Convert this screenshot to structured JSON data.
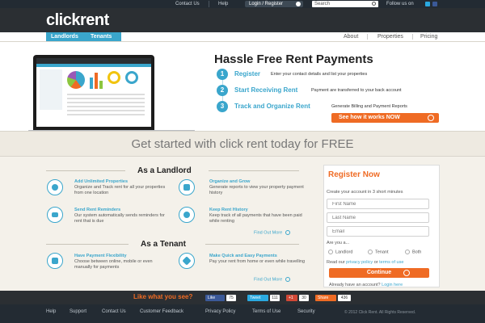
{
  "topbar": {
    "contact_us": "Contact Us",
    "help": "Help",
    "login_register": "Login / Register",
    "search_placeholder": "Search",
    "follow_us": "Follow us on"
  },
  "header": {
    "logo_click": "click",
    "logo_rent": "rent"
  },
  "nav": {
    "user_tabs": [
      "Landlords",
      "Tenants"
    ],
    "links": [
      "About",
      "Properties",
      "Pricing"
    ]
  },
  "hero": {
    "title": "Hassle Free Rent Payments",
    "steps": [
      {
        "num": "1",
        "title": "Register",
        "desc": "Enter your contact details and list your properties"
      },
      {
        "num": "2",
        "title": "Start Receiving Rent",
        "desc": "Payment are transferred to your back account"
      },
      {
        "num": "3",
        "title": "Track and Organize Rent",
        "desc": "Generate Billing and Payment Reports"
      }
    ],
    "cta": "See how it works NOW"
  },
  "banner": {
    "text": "Get started with click rent today for FREE"
  },
  "landlord": {
    "heading": "As a Landlord",
    "features": [
      {
        "title": "Add Unlimited Properties",
        "desc": "Organize and Track rent for all your properties from one location",
        "icon": "globe-icon"
      },
      {
        "title": "Organize and Grow",
        "desc": "Generate reports to view your property payment history",
        "icon": "tablet-icon"
      },
      {
        "title": "Send Rent Reminders",
        "desc": "Our system automatically sends reminders for rent that is due",
        "icon": "mail-icon"
      },
      {
        "title": "Keep Rent History",
        "desc": "Keep track of all payments that have been paid while renting",
        "icon": "history-icon"
      }
    ],
    "find_out_more": "Find Out More"
  },
  "tenant": {
    "heading": "As a Tenant",
    "features": [
      {
        "title": "Have Payment Flexibility",
        "desc": "Choose between online, mobile or even manually for payments",
        "icon": "devices-icon"
      },
      {
        "title": "Make Quick and Easy Payments",
        "desc": "Pay your rent from home or even while travelling",
        "icon": "lightning-icon"
      }
    ],
    "find_out_more": "Find Out More"
  },
  "register": {
    "title": "Register Now",
    "subtitle": "Create your account in 3 short minutes",
    "first_name": "First Name",
    "last_name": "Last Name",
    "email": "Email",
    "are_you": "Are you a...",
    "options": [
      "Landlord",
      "Tenant",
      "Both"
    ],
    "terms_pre": "Read our",
    "privacy": "privacy policy",
    "or": "or",
    "terms": "terms of use",
    "continue": "Continue",
    "login_pre": "Already have an account?",
    "login_link": "Login here"
  },
  "social": {
    "prompt": "Like what you see?",
    "buttons": [
      {
        "label": "Like",
        "count": "75",
        "color": "#3b5998"
      },
      {
        "label": "Tweet",
        "count": "111",
        "color": "#2aa9e0"
      },
      {
        "label": "+1",
        "count": "30",
        "color": "#d14836"
      },
      {
        "label": "Share",
        "count": "436",
        "color": "#ef6b24"
      }
    ]
  },
  "footer": {
    "links": [
      "Help",
      "Support",
      "Contact Us",
      "Customer Feedback",
      "Privacy Policy",
      "Terms of Use",
      "Security"
    ],
    "copyright": "© 2012 Click Rent. All Rights Reserved."
  },
  "colors": {
    "accent_blue": "#3aa6cc",
    "accent_orange": "#ef6b24",
    "dark": "#2b2f33"
  }
}
